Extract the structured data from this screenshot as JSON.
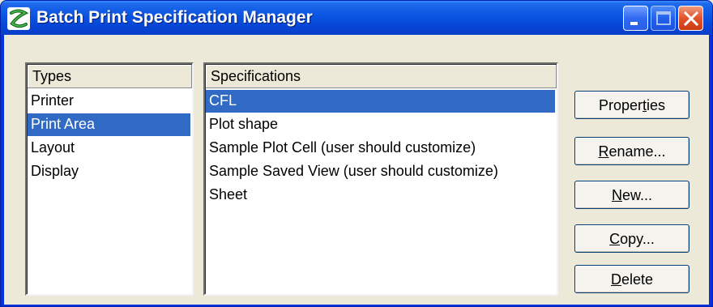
{
  "window": {
    "title": "Batch Print Specification Manager",
    "icon": "app-logo-icon",
    "controls": [
      "minimize-icon",
      "maximize-icon",
      "close-icon"
    ]
  },
  "types": {
    "header": "Types",
    "items": [
      "Printer",
      "Print Area",
      "Layout",
      "Display"
    ],
    "selected_index": 1
  },
  "specifications": {
    "header": "Specifications",
    "items": [
      "CFL",
      "Plot shape",
      "Sample Plot Cell (user should customize)",
      "Sample Saved View (user should customize)",
      "Sheet"
    ],
    "selected_index": 0
  },
  "buttons": {
    "properties": {
      "pre": "Proper",
      "key": "t",
      "post": "ies"
    },
    "rename": {
      "pre": "",
      "key": "R",
      "post": "ename..."
    },
    "new": {
      "pre": "",
      "key": "N",
      "post": "ew..."
    },
    "copy": {
      "pre": "",
      "key": "C",
      "post": "opy..."
    },
    "delete": {
      "pre": "",
      "key": "D",
      "post": "elete"
    }
  },
  "colors": {
    "selection": "#316ac5",
    "titlebar": "#0a54e0",
    "close": "#e0532b",
    "face": "#ece9d8"
  }
}
